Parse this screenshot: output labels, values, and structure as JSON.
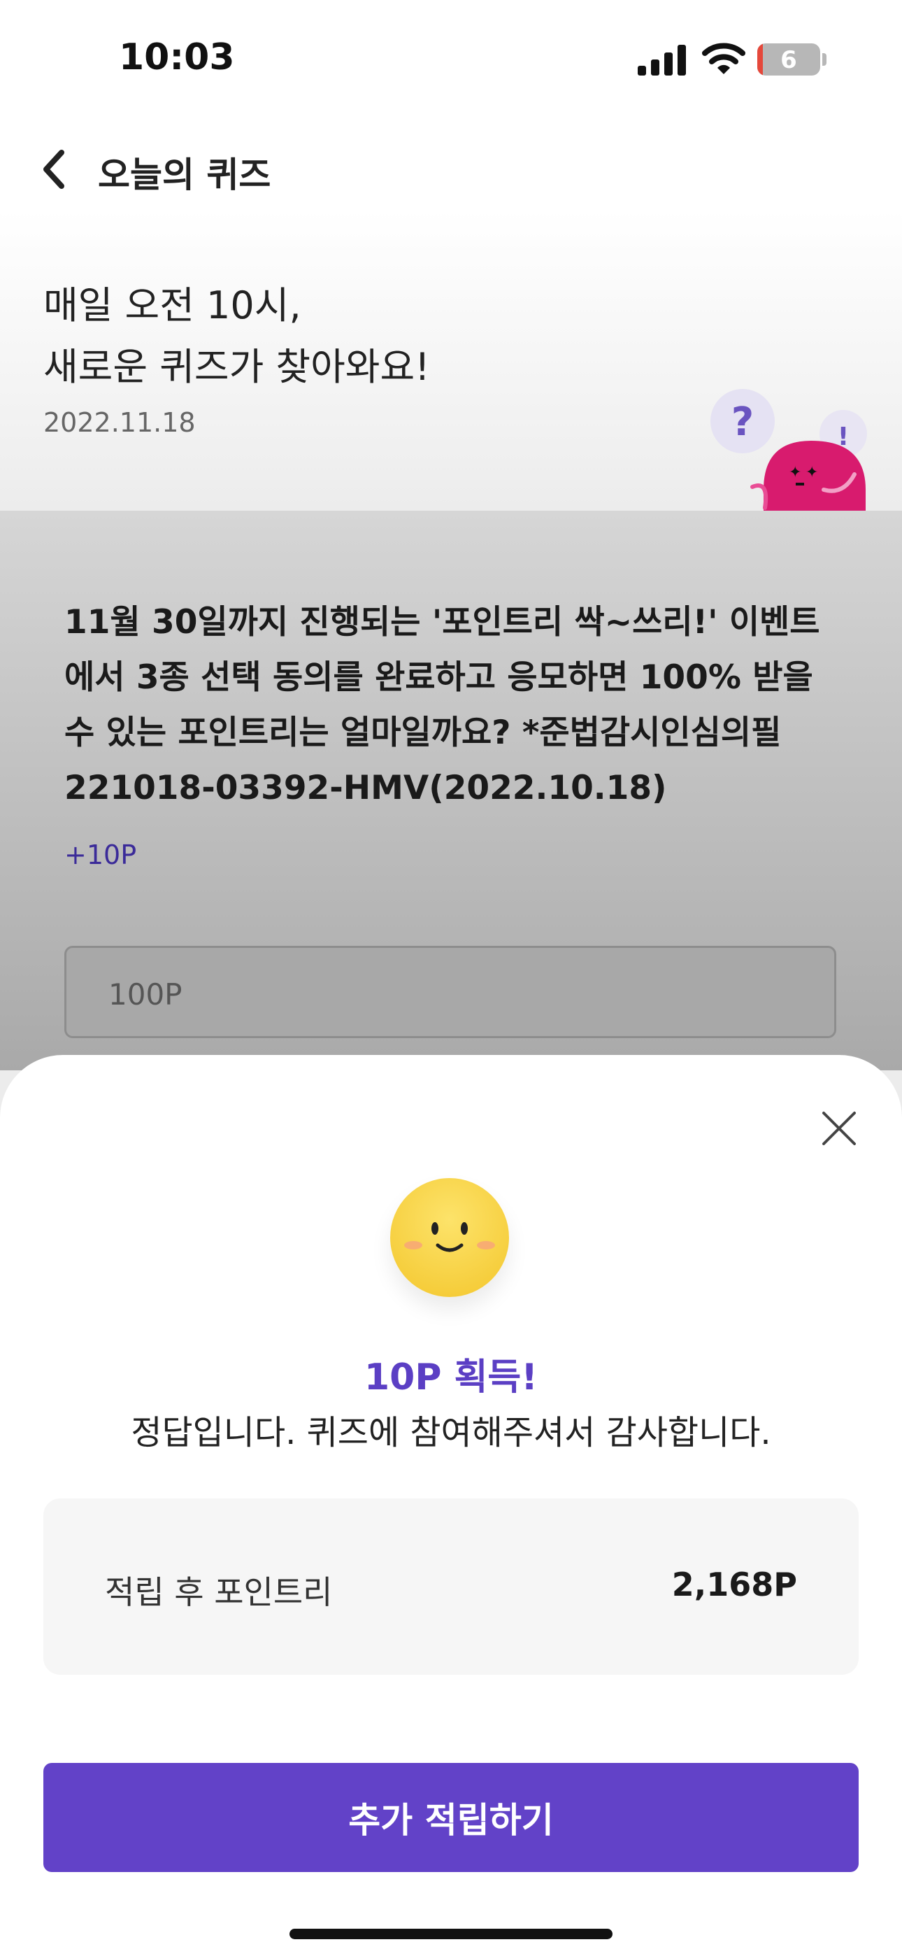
{
  "status_bar": {
    "time": "10:03",
    "battery_level": "6"
  },
  "nav": {
    "title": "오늘의 퀴즈"
  },
  "hero": {
    "line1": "매일 오전 10시,",
    "line2": "새로운 퀴즈가 찾아와요!",
    "date": "2022.11.18"
  },
  "quiz": {
    "question": "11월 30일까지 진행되는 '포인트리 싹~쓰리!' 이벤트에서 3종 선택 동의를 완료하고 응모하면 100% 받을 수 있는 포인트리는 얼마일까요? *준법감시인심의필 221018-03392-HMV(2022.10.18)",
    "reward": "+10P",
    "answer_value": "100P"
  },
  "result_sheet": {
    "title": "10P 획득!",
    "message": "정답입니다. 퀴즈에 참여해주셔서 감사합니다.",
    "points_label": "적립 후 포인트리",
    "points_value": "2,168P",
    "cta_label": "추가 적립하기"
  },
  "colors": {
    "accent": "#6242c8",
    "reward_text": "#3b2b99",
    "mascot": "#d81b6e",
    "smiley": "#f5cc35"
  },
  "icons": [
    "back-icon",
    "signal-icon",
    "wifi-icon",
    "battery-icon",
    "close-icon",
    "mascot-icon",
    "smiley-icon"
  ]
}
